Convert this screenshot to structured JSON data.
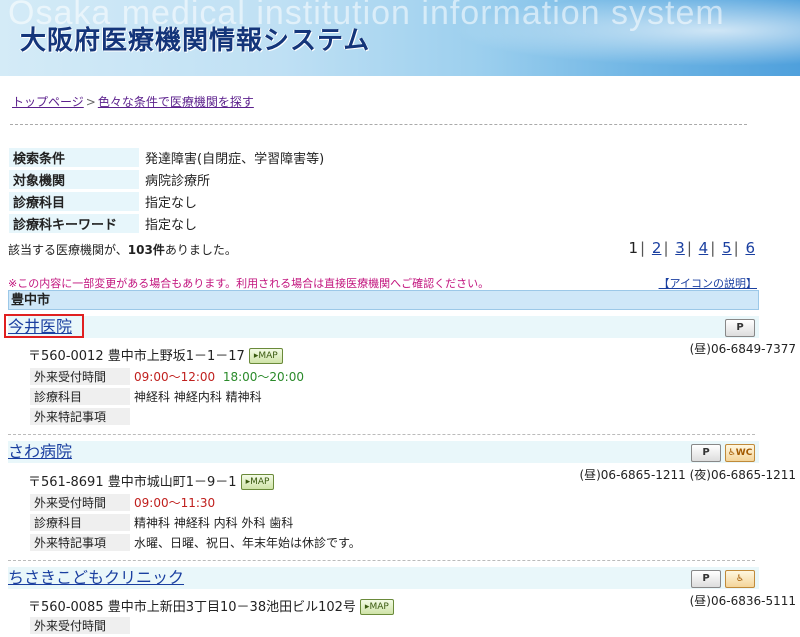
{
  "banner": {
    "title": "大阪府医療機関情報システム",
    "background_text": "Osaka medical institution information system"
  },
  "breadcrumb": {
    "home": "トップページ",
    "separator": ">",
    "current": "色々な条件で医療機関を探す"
  },
  "conditions": [
    {
      "key": "検索条件",
      "value": "発達障害(自閉症、学習障害等)"
    },
    {
      "key": "対象機関",
      "value": "病院診療所"
    },
    {
      "key": "診療科目",
      "value": "指定なし"
    },
    {
      "key": "診療科キーワード",
      "value": "指定なし"
    }
  ],
  "result": {
    "prefix": "該当する医療機関が、",
    "count": "103件",
    "suffix": "ありました。"
  },
  "pager": {
    "current": "1",
    "pages": [
      "2",
      "3",
      "4",
      "5",
      "6"
    ],
    "separator": "|"
  },
  "notice": "※この内容に一部変更がある場合もあります。利用される場合は直接医療機関へご確認ください。",
  "icon_help": "【アイコンの説明】",
  "city": "豊中市",
  "labels": {
    "hours": "外来受付時間",
    "depts": "診療科目",
    "notes": "外来特記事項",
    "map": "MAP",
    "parking": "P",
    "wc": "WC",
    "wheelchair": "♿"
  },
  "entries": [
    {
      "name": "今井医院",
      "postal": "〒560-0012",
      "address": "豊中市上野坂1－1－17",
      "phone": "(昼)06-6849-7377",
      "hours_a": "09:00～12:00",
      "hours_b": "18:00～20:00",
      "depts": "神経科 神経内科 精神科",
      "notes": ""
    },
    {
      "name": "さわ病院",
      "postal": "〒561-8691",
      "address": "豊中市城山町1－9－1",
      "phone": "(昼)06-6865-1211 (夜)06-6865-1211",
      "hours_a": "09:00～11:30",
      "hours_b": "",
      "depts": "精神科 神経科 内科 外科 歯科",
      "notes": "水曜、日曜、祝日、年末年始は休診です。"
    },
    {
      "name": "ちさきこどもクリニック",
      "postal": "〒560-0085",
      "address": "豊中市上新田3丁目10－38池田ビル102号",
      "phone": "(昼)06-6836-5111",
      "hours_a": "",
      "hours_b": "",
      "depts": "",
      "notes": ""
    }
  ]
}
